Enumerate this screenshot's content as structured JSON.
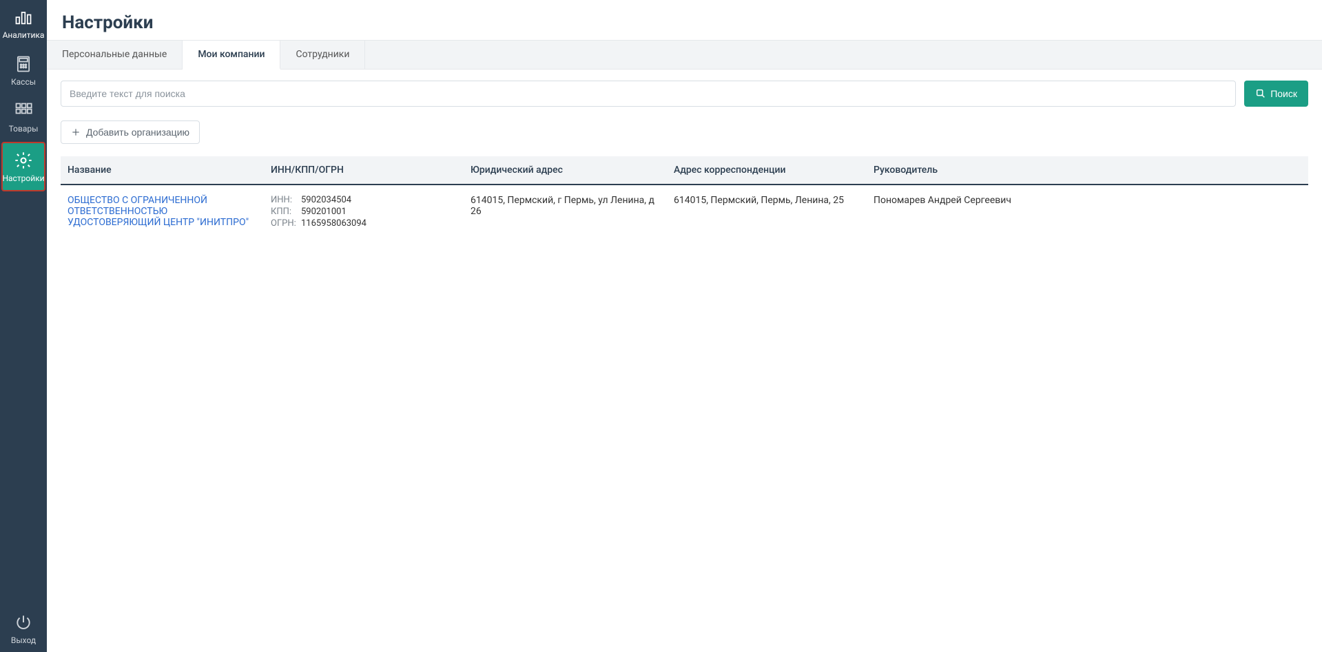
{
  "sidebar": {
    "items": [
      {
        "label": "Аналитика"
      },
      {
        "label": "Кассы"
      },
      {
        "label": "Товары"
      },
      {
        "label": "Настройки"
      }
    ],
    "logout": "Выход"
  },
  "page": {
    "title": "Настройки"
  },
  "tabs": [
    {
      "label": "Персональные данные"
    },
    {
      "label": "Мои компании"
    },
    {
      "label": "Сотрудники"
    }
  ],
  "search": {
    "placeholder": "Введите текст для поиска",
    "button": "Поиск"
  },
  "add_button": "Добавить организацию",
  "table": {
    "headers": {
      "name": "Название",
      "inn": "ИНН/КПП/ОГРН",
      "legal": "Юридический адрес",
      "corr": "Адрес корреспонденции",
      "head": "Руководитель"
    },
    "rows": [
      {
        "name": "ОБЩЕСТВО С ОГРАНИЧЕННОЙ ОТВЕТСТВЕННОСТЬЮ УДОСТОВЕРЯЮЩИЙ ЦЕНТР \"ИНИТПРО\"",
        "inn_label": "ИНН:",
        "inn": "5902034504",
        "kpp_label": "КПП:",
        "kpp": "590201001",
        "ogrn_label": "ОГРН:",
        "ogrn": "1165958063094",
        "legal": "614015, Пермский, г Пермь, ул Ленина, д 26",
        "corr": "614015, Пермский, Пермь, Ленина, 25",
        "head": "Пономарев Андрей Сергеевич"
      }
    ]
  }
}
